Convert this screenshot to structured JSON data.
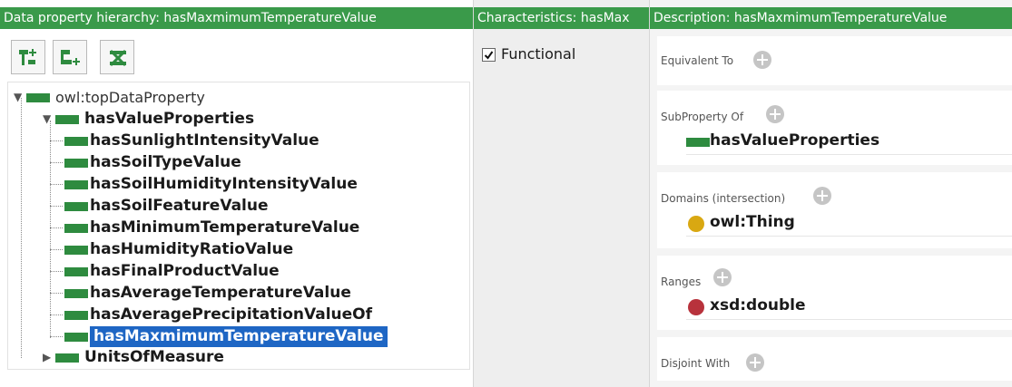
{
  "hierarchy_panel": {
    "title": "Data property hierarchy: hasMaxmimumTemperatureValue",
    "toolbar": [
      "add-subproperty-icon",
      "add-sibling-icon",
      "delete-property-icon"
    ],
    "root": "owl:topDataProperty",
    "group": "hasValueProperties",
    "children": [
      "hasSunlightIntensityValue",
      "hasSoilTypeValue",
      "hasSoilHumidityIntensityValue",
      "hasSoilFeatureValue",
      "hasMinimumTemperatureValue",
      "hasHumidityRatioValue",
      "hasFinalProductValue",
      "hasAverageTemperatureValue",
      "hasAveragePrecipitationValueOf",
      "hasMaxmimumTemperatureValue"
    ],
    "selected": "hasMaxmimumTemperatureValue",
    "other": "UnitsOfMeasure"
  },
  "characteristics_panel": {
    "title": "Characteristics: hasMax",
    "functional_label": "Functional",
    "functional_checked": true
  },
  "description_panel": {
    "title": "Description: hasMaxmimumTemperatureValue",
    "equivalent_to": "Equivalent To",
    "subproperty_of": "SubProperty Of",
    "subproperty_value": "hasValueProperties",
    "domains": "Domains (intersection)",
    "domain_value": "owl:Thing",
    "ranges": "Ranges",
    "range_value": "xsd:double",
    "disjoint_with": "Disjoint With"
  },
  "colors": {
    "header_green": "#3a9a4a",
    "property_green": "#2e8b3f",
    "selection_blue": "#1e66c4",
    "thing_yellow": "#d9a812",
    "datatype_red": "#b8323c"
  }
}
